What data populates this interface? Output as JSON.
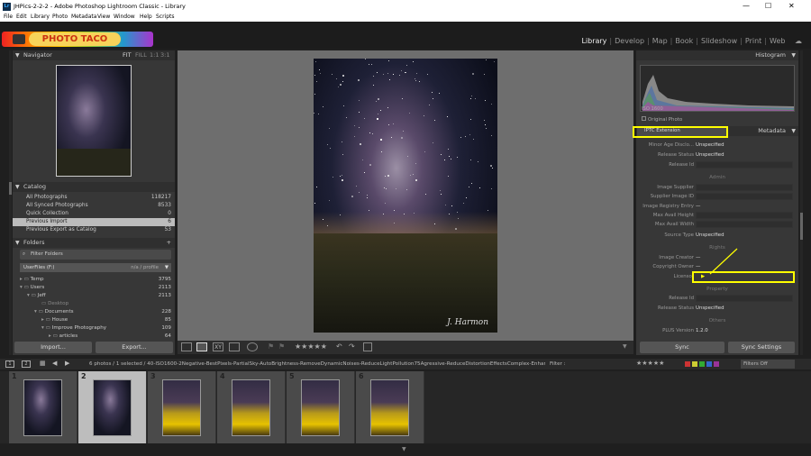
{
  "window": {
    "title": "JHPics-2-2-2 - Adobe Photoshop Lightroom Classic - Library",
    "minimize": "—",
    "maximize": "☐",
    "close": "✕"
  },
  "menu": [
    "File",
    "Edit",
    "Library",
    "Photo",
    "Metadata",
    "View",
    "Window",
    "Help",
    "Scripts"
  ],
  "logo_text": "PHOTO TACO",
  "modules": [
    "Library",
    "Develop",
    "Map",
    "Book",
    "Slideshow",
    "Print",
    "Web"
  ],
  "active_module": "Library",
  "navigator": {
    "title": "Navigator",
    "zoom": [
      "FIT",
      "FILL",
      "1:1",
      "3:1"
    ]
  },
  "catalog": {
    "title": "Catalog",
    "items": [
      {
        "label": "All Photographs",
        "count": "118217"
      },
      {
        "label": "All Synced Photographs",
        "count": "8533"
      },
      {
        "label": "Quick Collection",
        "count": "0"
      },
      {
        "label": "Previous Import",
        "count": "6"
      },
      {
        "label": "Previous Export as Catalog",
        "count": "53"
      }
    ]
  },
  "folders": {
    "title": "Folders",
    "filter_label": "Filter Folders",
    "volume": "UserFiles (F:)",
    "volume_info": "n/a / profile",
    "items": [
      {
        "label": "Temp",
        "count": "3795",
        "indent": 1
      },
      {
        "label": "Users",
        "count": "2113",
        "indent": 1
      },
      {
        "label": "Jeff",
        "count": "2113",
        "indent": 2
      },
      {
        "label": "Desktop",
        "count": "",
        "indent": 3
      },
      {
        "label": "Documents",
        "count": "228",
        "indent": 3
      },
      {
        "label": "House",
        "count": "85",
        "indent": 4
      },
      {
        "label": "Improve Photography",
        "count": "109",
        "indent": 4
      },
      {
        "label": "articles",
        "count": "64",
        "indent": 5
      }
    ]
  },
  "left_buttons": {
    "import": "Import...",
    "export": "Export..."
  },
  "main_image": {
    "signature": "J. Harmon"
  },
  "histogram": {
    "title": "Histogram",
    "iso": "ISO 1600",
    "focal": "",
    "shutter": "",
    "exposure": "",
    "original_photo": "Original Photo"
  },
  "metadata": {
    "title": "Metadata",
    "preset": "IPTC Extension",
    "rows": [
      {
        "key": "Minor Age Disclo...",
        "value": "Unspecified"
      },
      {
        "key": "Release Status",
        "value": "Unspecified"
      },
      {
        "key": "Release Id",
        "value": ""
      },
      {
        "key": "Image Supplier",
        "value": ""
      },
      {
        "key": "Supplier Image ID",
        "value": ""
      },
      {
        "key": "Image Registry Entry",
        "value": "—"
      },
      {
        "key": "Max Avail Height",
        "value": ""
      },
      {
        "key": "Max Avail Width",
        "value": ""
      },
      {
        "key": "Source Type",
        "value": "Unspecified"
      },
      {
        "key": "Image Creator",
        "value": "—"
      },
      {
        "key": "Copyright Owner",
        "value": "—"
      },
      {
        "key": "Licensor",
        "value": "▶"
      },
      {
        "key": "Release Id",
        "value": ""
      },
      {
        "key": "Release Status",
        "value": "Unspecified"
      },
      {
        "key": "PLUS Version",
        "value": "1.2.0"
      }
    ],
    "sections": {
      "admin": "Admin",
      "rights": "Rights",
      "property": "Property",
      "others": "Others"
    }
  },
  "right_buttons": {
    "sync": "Sync",
    "sync_settings": "Sync Settings"
  },
  "filmstrip": {
    "pages": [
      "1",
      "2"
    ],
    "info": "6 photos / 1 selected / 40-ISO1600-2Negative-BestPixels-PartialSky-AutoBrightness-RemoveDynamicNoises-ReduceLightPollution75Agressive-ReduceDistortionEffectsComplex-EnhanceStarlight-P",
    "filter_label": "Filter :",
    "filters_off": "Filters Off",
    "thumbs": [
      "1",
      "2",
      "3",
      "4",
      "5",
      "6"
    ],
    "selected_index": 1
  }
}
